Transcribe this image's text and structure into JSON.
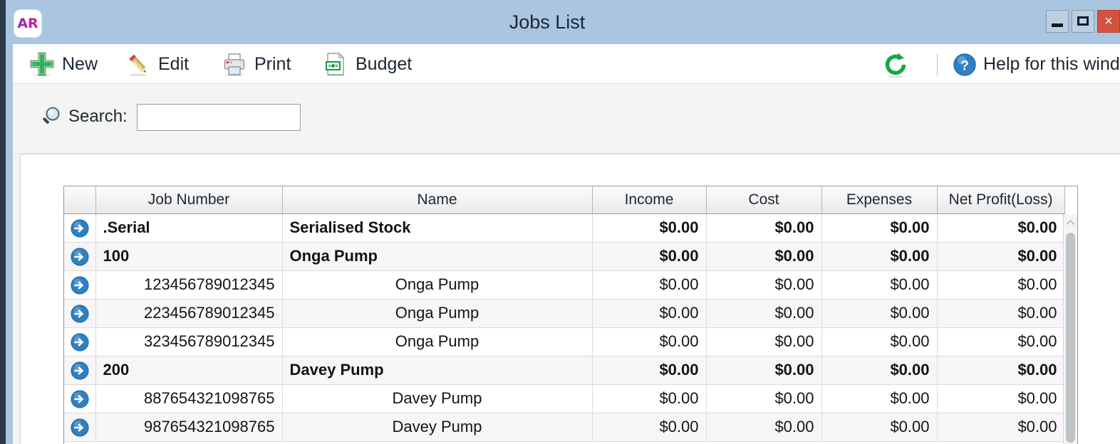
{
  "window": {
    "title": "Jobs List",
    "logo_text": "AR",
    "controls": {
      "minimize": "Minimize",
      "maximize": "Maximize",
      "close": "×"
    }
  },
  "toolbar": {
    "buttons": [
      {
        "label": "New",
        "icon": "plus-icon"
      },
      {
        "label": "Edit",
        "icon": "pencil-icon"
      },
      {
        "label": "Print",
        "icon": "printer-icon"
      },
      {
        "label": "Budget",
        "icon": "budget-document-icon"
      }
    ],
    "refresh": {
      "label": "Refresh",
      "icon": "refresh-icon"
    },
    "help": {
      "label": "Help for this window",
      "icon": "help-icon"
    }
  },
  "search": {
    "label": "Search:",
    "value": "",
    "placeholder": "",
    "icon": "magnifier-icon"
  },
  "grid": {
    "columns": [
      {
        "key": "indicator",
        "label": ""
      },
      {
        "key": "job_number",
        "label": "Job Number"
      },
      {
        "key": "name",
        "label": "Name"
      },
      {
        "key": "income",
        "label": "Income"
      },
      {
        "key": "cost",
        "label": "Cost"
      },
      {
        "key": "expenses",
        "label": "Expenses"
      },
      {
        "key": "net_profit",
        "label": "Net Profit(Loss)"
      }
    ],
    "rows": [
      {
        "job_number": ".Serial",
        "name": "Serialised Stock",
        "income": "$0.00",
        "cost": "$0.00",
        "expenses": "$0.00",
        "net_profit": "$0.00",
        "group": true,
        "align": "left"
      },
      {
        "job_number": "100",
        "name": "Onga Pump",
        "income": "$0.00",
        "cost": "$0.00",
        "expenses": "$0.00",
        "net_profit": "$0.00",
        "group": true,
        "align": "indent"
      },
      {
        "job_number": "123456789012345",
        "name": "Onga Pump",
        "income": "$0.00",
        "cost": "$0.00",
        "expenses": "$0.00",
        "net_profit": "$0.00",
        "group": false,
        "align": "right"
      },
      {
        "job_number": "223456789012345",
        "name": "Onga Pump",
        "income": "$0.00",
        "cost": "$0.00",
        "expenses": "$0.00",
        "net_profit": "$0.00",
        "group": false,
        "align": "right"
      },
      {
        "job_number": "323456789012345",
        "name": "Onga Pump",
        "income": "$0.00",
        "cost": "$0.00",
        "expenses": "$0.00",
        "net_profit": "$0.00",
        "group": false,
        "align": "right"
      },
      {
        "job_number": "200",
        "name": "Davey Pump",
        "income": "$0.00",
        "cost": "$0.00",
        "expenses": "$0.00",
        "net_profit": "$0.00",
        "group": true,
        "align": "indent"
      },
      {
        "job_number": "887654321098765",
        "name": "Davey Pump",
        "income": "$0.00",
        "cost": "$0.00",
        "expenses": "$0.00",
        "net_profit": "$0.00",
        "group": false,
        "align": "right"
      },
      {
        "job_number": "987654321098765",
        "name": "Davey Pump",
        "income": "$0.00",
        "cost": "$0.00",
        "expenses": "$0.00",
        "net_profit": "$0.00",
        "group": false,
        "align": "right"
      }
    ],
    "row_indicator_icon": "blue-arrow-right-icon",
    "scrollbar": {
      "up_arrow": "chevron-up-icon"
    }
  },
  "colors": {
    "title_bar": "#a9c5e0",
    "close_button": "#d4523f",
    "accent_green": "#2fb055",
    "accent_blue": "#2f80c2",
    "row_alt": "#f8f5f8"
  }
}
